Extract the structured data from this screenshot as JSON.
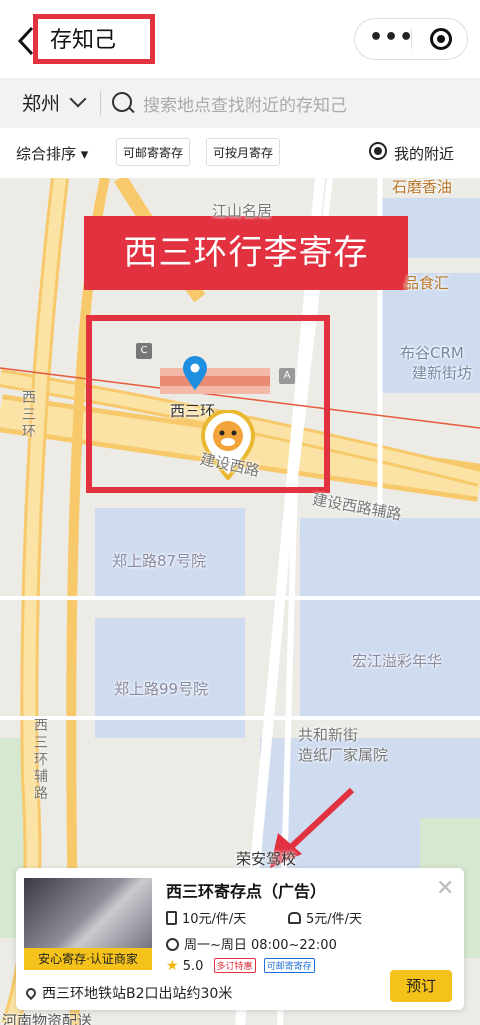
{
  "nav": {
    "title": "存知己",
    "more_label": "•••"
  },
  "search": {
    "city": "郑州",
    "placeholder": "搜索地点查找附近的存知己"
  },
  "filters": {
    "sort_label": "综合排序 ▾",
    "chip1": "可邮寄寄存",
    "chip2": "可按月寄存",
    "nearby_label": "我的附近"
  },
  "map": {
    "banner": "西三环行李寄存",
    "labels": {
      "poi1": "石磨香油",
      "poi2": "江山名居",
      "poi3": "品食汇",
      "poi4": "布谷CRM",
      "poi5": "建新街坊",
      "station": "西三环",
      "road1": "建设西路",
      "road2": "建设西路辅路",
      "courtyard1": "郑上路87号院",
      "courtyard2": "郑上路99号院",
      "poi6": "宏江溢彩年华",
      "poi7": "共和新街",
      "poi8": "造纸厂家属院",
      "school": "荣安驾校",
      "bottom": "河南物资配送",
      "v1": "西三环",
      "v2": "西三环辅路",
      "a_mark": "A",
      "c_mark": "C"
    }
  },
  "card": {
    "title": "西三环寄存点（广告）",
    "thumb_caption": "安心寄存·认证商家",
    "price1": "10元/件/天",
    "price2": "5元/件/天",
    "hours": "周一~周日 08:00~22:00",
    "rating": "5.0",
    "tag1": "多订特惠",
    "tag2": "可邮寄寄存",
    "address": "西三环地铁站B2口出站约30米",
    "book_label": "预订",
    "close": "✕"
  }
}
